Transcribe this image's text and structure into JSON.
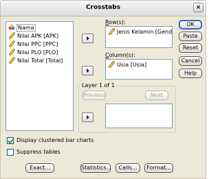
{
  "window": {
    "title": "Crosstabs",
    "close_glyph": "×"
  },
  "source_list": {
    "items": [
      {
        "label": "Nama",
        "icon": "string-variable-icon"
      },
      {
        "label": "Nilai APK [APK]",
        "icon": "scale-variable-icon"
      },
      {
        "label": "Nilai PPC [PPC]",
        "icon": "scale-variable-icon"
      },
      {
        "label": "Nilai PLO [PLO]",
        "icon": "scale-variable-icon"
      },
      {
        "label": "Nilai Total [Total]",
        "icon": "scale-variable-icon"
      }
    ]
  },
  "rows": {
    "label_pre": "",
    "label_u": "R",
    "label_post": "ow(s):",
    "items": [
      {
        "label": "Jenis Kelamin [Gender",
        "icon": "scale-variable-icon"
      }
    ]
  },
  "columns": {
    "label_pre": "",
    "label_u": "C",
    "label_post": "olumn(s):",
    "items": [
      {
        "label": "Usia [Usia]",
        "icon": "scale-variable-icon"
      }
    ]
  },
  "layer": {
    "title": "Layer 1 of 1",
    "previous": "Previous",
    "next": "Next"
  },
  "buttons": {
    "ok": "OK",
    "paste": "Paste",
    "reset": "Reset",
    "cancel": "Cancel",
    "help": "Help",
    "exact": "Exact...",
    "statistics": "Statistics...",
    "cells": "Cells...",
    "format": "Format..."
  },
  "options": {
    "clustered": {
      "label": "Display clustered bar charts",
      "checked": true
    },
    "suppress": {
      "label": "Suppress tables",
      "checked": false
    }
  }
}
